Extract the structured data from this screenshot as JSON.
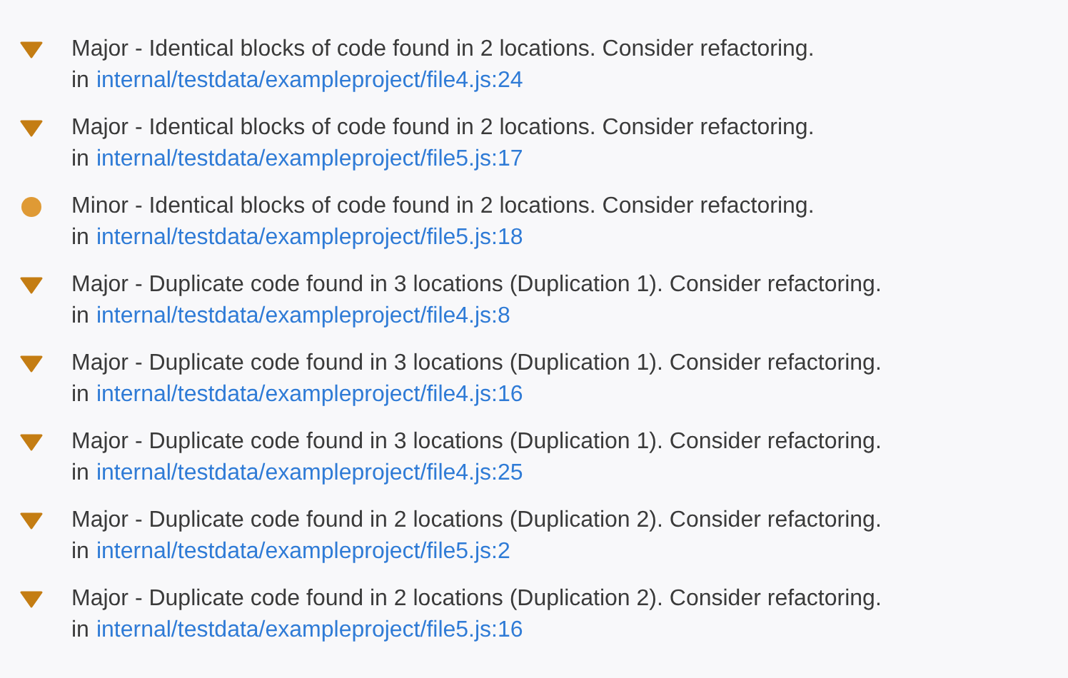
{
  "issues": [
    {
      "kind": "major",
      "message": "Major - Identical blocks of code found in 2 locations. Consider refactoring.",
      "prefix": "in",
      "location": "internal/testdata/exampleproject/file4.js:24"
    },
    {
      "kind": "major",
      "message": "Major - Identical blocks of code found in 2 locations. Consider refactoring.",
      "prefix": "in",
      "location": "internal/testdata/exampleproject/file5.js:17"
    },
    {
      "kind": "minor",
      "message": "Minor - Identical blocks of code found in 2 locations. Consider refactoring.",
      "prefix": "in",
      "location": "internal/testdata/exampleproject/file5.js:18"
    },
    {
      "kind": "major",
      "message": "Major - Duplicate code found in 3 locations (Duplication 1). Consider refactoring.",
      "prefix": "in",
      "location": "internal/testdata/exampleproject/file4.js:8"
    },
    {
      "kind": "major",
      "message": "Major - Duplicate code found in 3 locations (Duplication 1). Consider refactoring.",
      "prefix": "in",
      "location": "internal/testdata/exampleproject/file4.js:16"
    },
    {
      "kind": "major",
      "message": "Major - Duplicate code found in 3 locations (Duplication 1). Consider refactoring.",
      "prefix": "in",
      "location": "internal/testdata/exampleproject/file4.js:25"
    },
    {
      "kind": "major",
      "message": "Major - Duplicate code found in 2 locations (Duplication 2). Consider refactoring.",
      "prefix": "in",
      "location": "internal/testdata/exampleproject/file5.js:2"
    },
    {
      "kind": "major",
      "message": "Major - Duplicate code found in 2 locations (Duplication 2). Consider refactoring.",
      "prefix": "in",
      "location": "internal/testdata/exampleproject/file5.js:16"
    }
  ]
}
